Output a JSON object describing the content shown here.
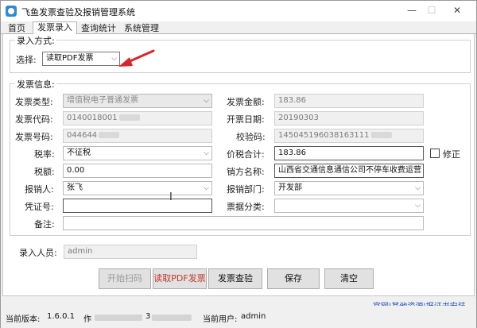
{
  "window": {
    "title": "飞鱼发票查验及报销管理系统"
  },
  "tabs": [
    "首页",
    "发票录入",
    "查询统计",
    "系统管理"
  ],
  "entry_mode": {
    "legend": "录入方式:",
    "select_label": "选择:",
    "select_value": "读取PDF发票"
  },
  "invoice_info": {
    "legend": "发票信息:",
    "type_label": "发票类型:",
    "type_value": "增值税电子普通发票",
    "amount_label": "发票金额:",
    "amount_value": "183.86",
    "code_label": "发票代码:",
    "code_value": "0140018001",
    "date_label": "开票日期:",
    "date_value": "20190303",
    "number_label": "发票号码:",
    "number_value": "044644",
    "check_label": "校验码:",
    "check_value": "145045196038163111",
    "tax_rate_label": "税率:",
    "tax_rate_value": "不征税",
    "total_label": "价税合计:",
    "total_value": "183.86",
    "correct_label": "修正",
    "tax_amount_label": "税额:",
    "tax_amount_value": "0.00",
    "seller_label": "销方名称:",
    "seller_value": "山西省交通信息通信公司不停车收费运营",
    "reimburser_label": "报销人:",
    "reimburser_value": "张飞",
    "dept_label": "报销部门:",
    "dept_value": "开发部",
    "voucher_label": "凭证号:",
    "voucher_value": "",
    "category_label": "票据分类:",
    "category_value": "",
    "remark_label": "备注:",
    "remark_value": ""
  },
  "entry_person": {
    "label": "录入人员:",
    "value": "admin"
  },
  "buttons": {
    "start_scan": "开始扫码",
    "read_pdf": "读取PDF发票",
    "verify": "发票查验",
    "save": "保存",
    "clear": "清空"
  },
  "status": {
    "version_label": "当前版本:",
    "version_value": "1.6.0.1",
    "machine_label": "作",
    "machine_value": "3",
    "user_label": "当前用户:",
    "user_value": "admin",
    "links": "官网|其他资源|报证书安装"
  },
  "colors": {
    "accent": "#1a4fb8",
    "arrow": "#d9262a"
  }
}
